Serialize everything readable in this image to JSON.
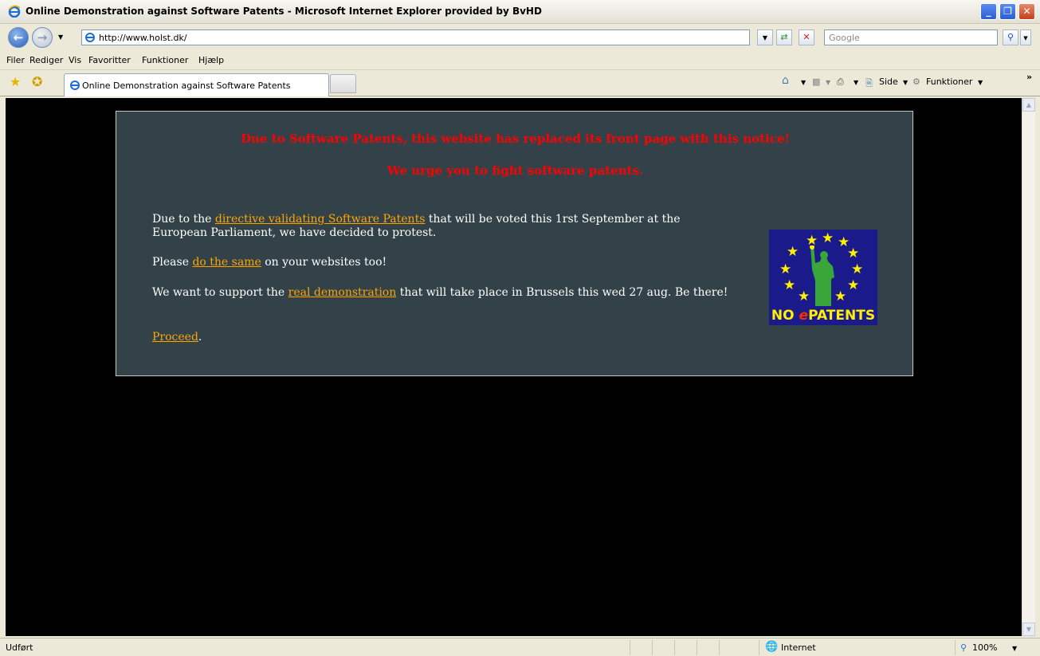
{
  "window": {
    "title": "Online Demonstration against Software Patents - Microsoft Internet Explorer provided by BvHD",
    "controls": {
      "minimize": "_",
      "restore": "❐",
      "close": "✕"
    }
  },
  "address": {
    "url": "http://www.holst.dk/",
    "search_placeholder": "Google"
  },
  "menu": [
    "Filer",
    "Rediger",
    "Vis",
    "Favoritter",
    "Funktioner",
    "Hjælp"
  ],
  "tabs": [
    {
      "label": "Online Demonstration against Software Patents",
      "active": true
    }
  ],
  "command_bar": {
    "page_label": "Side",
    "tools_label": "Funktioner",
    "more": "»"
  },
  "page": {
    "headline1": "Due to Software Patents, this website has replaced its front page with this notice!",
    "headline2": "We urge you to fight software patents.",
    "p1_before": "Due to the ",
    "p1_link": "directive validating Software Patents",
    "p1_after_line1": " that will be voted this 1rst September at the",
    "p1_line2": "European Parliament, we have decided to protest.",
    "p2_before": "Please ",
    "p2_link": "do the same",
    "p2_after": " on your websites too!",
    "p3_before": "We want to support the ",
    "p3_link": "real demonstration",
    "p3_after": " that will take place in Brussels this wed 27 aug. Be there!",
    "proceed_link": "Proceed",
    "proceed_after": ".",
    "logo": {
      "no": "NO ",
      "e": "e",
      "patents": "PATENTS"
    }
  },
  "status": {
    "left": "Udført",
    "zone": "Internet",
    "zoom": "100%"
  },
  "colors": {
    "notice_bg": "#324248",
    "headline": "#ff0000",
    "link": "#ffa500",
    "content_bg": "#000000"
  }
}
